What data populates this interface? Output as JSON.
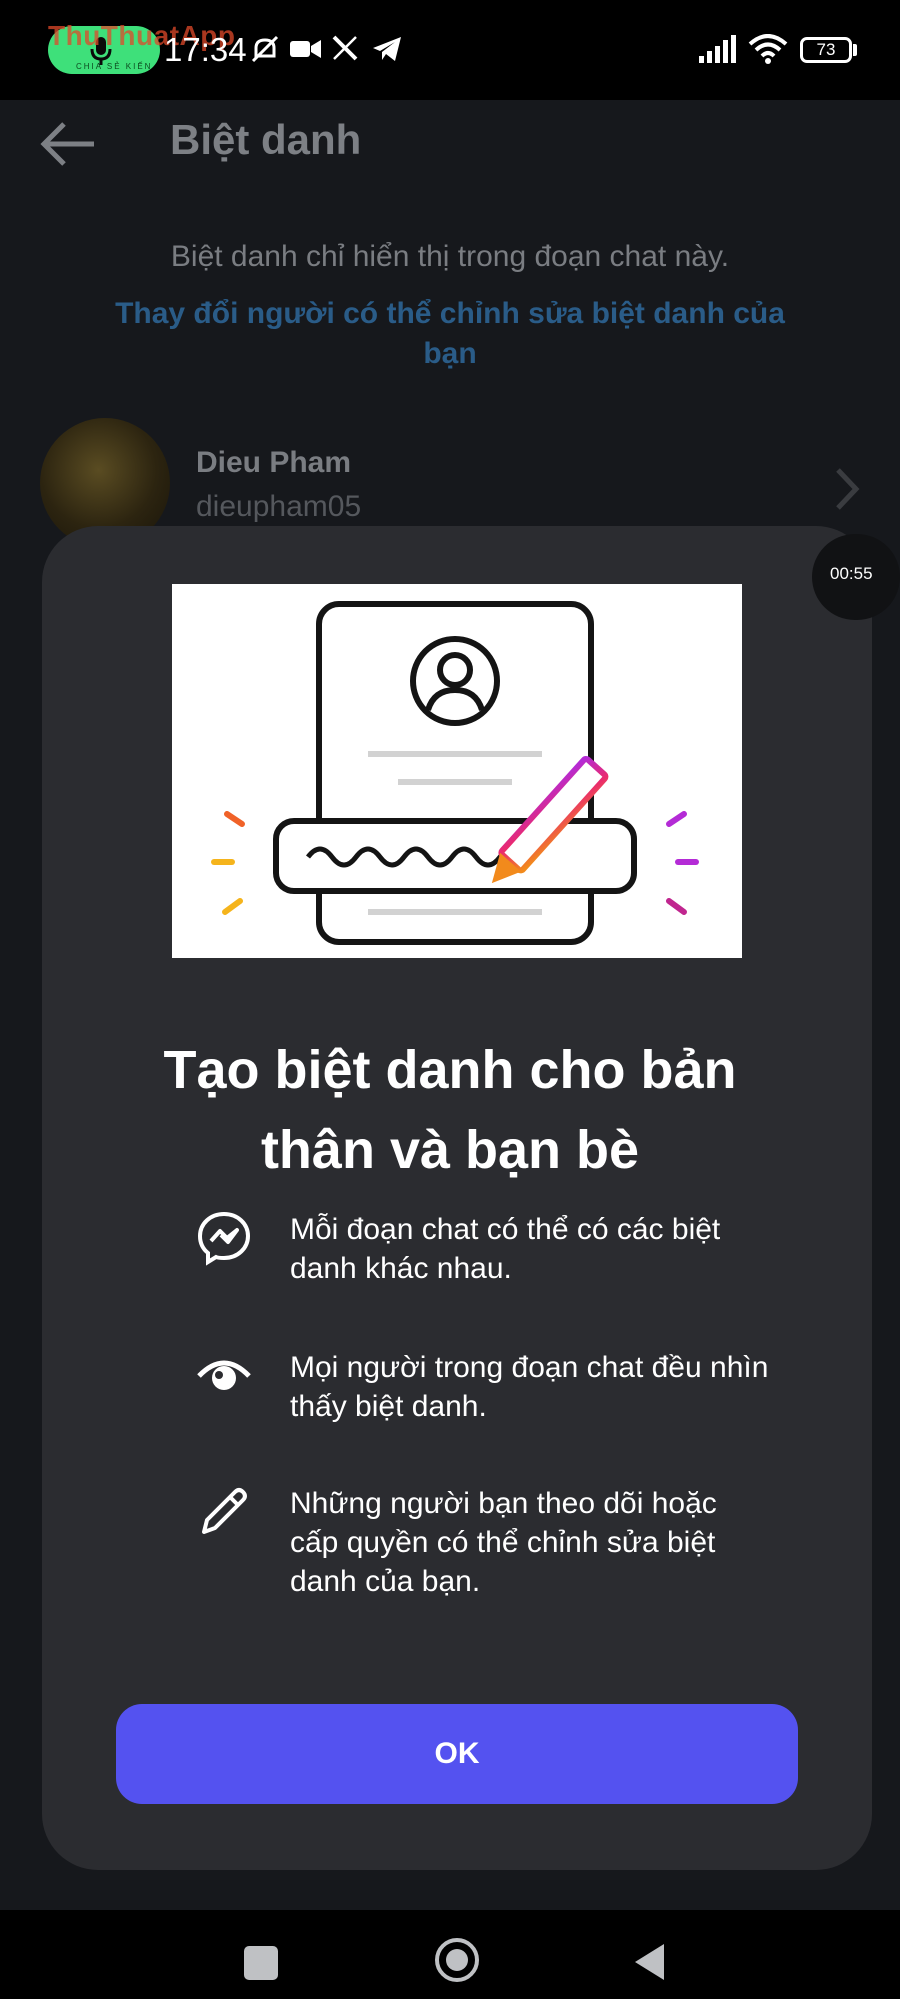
{
  "status_bar": {
    "time": "17:34",
    "battery": "73",
    "watermark": "ThuThuatApp",
    "watermark_sub": "CHIA SẺ KIẾN"
  },
  "header": {
    "title": "Biệt danh",
    "hint": "Biệt danh chỉ hiển thị trong đoạn chat này.",
    "change_link": "Thay đổi người có thể chỉnh sửa biệt danh của bạn"
  },
  "member": {
    "name": "Dieu Pham",
    "username": "dieupham05"
  },
  "recording": {
    "timer": "00:55"
  },
  "sheet": {
    "headline": "Tạo biệt danh cho bản thân và bạn bè",
    "features": [
      {
        "icon": "messenger-icon",
        "text": "Mỗi đoạn chat có thể có các biệt danh khác nhau."
      },
      {
        "icon": "eye-icon",
        "text": "Mọi người trong đoạn chat đều nhìn thấy biệt danh."
      },
      {
        "icon": "pencil-icon",
        "text": "Những người bạn theo dõi hoặc cấp quyền có thể chỉnh sửa biệt danh của bạn."
      }
    ],
    "ok_label": "OK"
  },
  "colors": {
    "sheet_bg": "#2b2c30",
    "ok_button": "#5452f0",
    "link": "#2a5c88"
  }
}
